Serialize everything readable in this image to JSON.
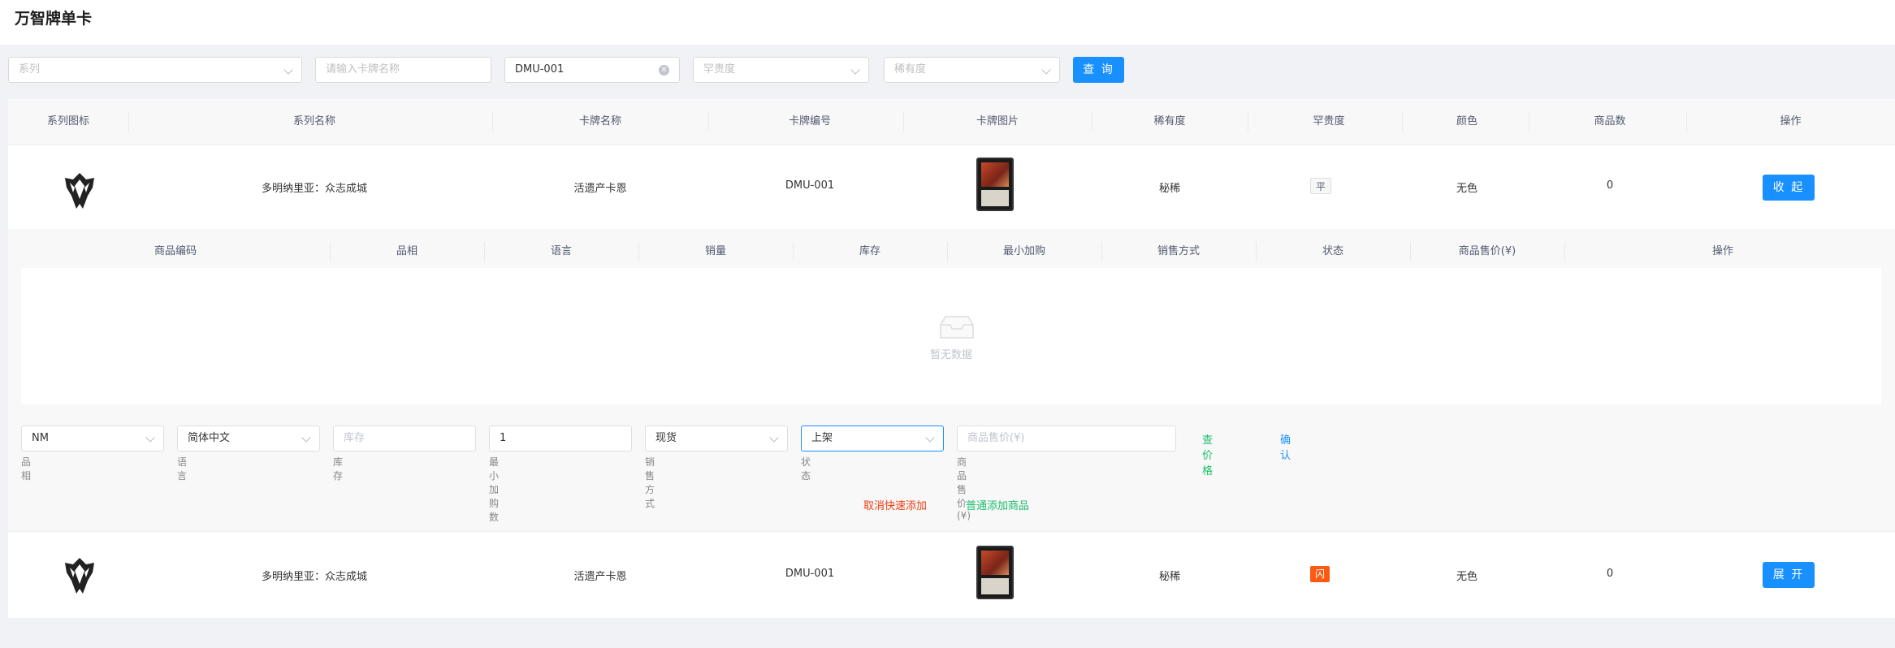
{
  "app": {
    "title": "万智牌单卡"
  },
  "filters": {
    "series_placeholder": "系列",
    "name_placeholder": "请输入卡牌名称",
    "code_value": "DMU-001",
    "rarity_placeholder": "罕贵度",
    "scarcity_placeholder": "稀有度",
    "query_label": "查 询"
  },
  "table": {
    "headers": [
      "系列图标",
      "系列名称",
      "卡牌名称",
      "卡牌编号",
      "卡牌图片",
      "稀有度",
      "罕贵度",
      "颜色",
      "商品数",
      "操作"
    ],
    "rows": [
      {
        "series": "多明纳里亚：众志成城",
        "name": "活遗产卡恩",
        "code": "DMU-001",
        "scarcity": "秘稀",
        "rarity_tag": "平",
        "color": "无色",
        "count": "0",
        "action": "收 起"
      },
      {
        "series": "多明纳里亚：众志成城",
        "name": "活遗产卡恩",
        "code": "DMU-001",
        "scarcity": "秘稀",
        "rarity_tag": "闪",
        "color": "无色",
        "count": "0",
        "action": "展 开"
      }
    ]
  },
  "subtable": {
    "headers": [
      "商品编码",
      "品相",
      "语言",
      "销量",
      "库存",
      "最小加购",
      "销售方式",
      "状态",
      "商品售价(¥)",
      "操作"
    ],
    "empty_text": "暂无数据"
  },
  "add_form": {
    "condition": {
      "value": "NM",
      "label": "品相"
    },
    "language": {
      "value": "简体中文",
      "label": "语言"
    },
    "stock": {
      "placeholder": "库存",
      "label": "库存"
    },
    "min_qty": {
      "value": "1",
      "label": "最小加购数"
    },
    "sale_method": {
      "value": "现货",
      "label": "销售方式"
    },
    "status": {
      "value": "上架",
      "label": "状态"
    },
    "price": {
      "placeholder": "商品售价(¥)",
      "label": "商品售价(¥)"
    },
    "check_price": "查价格",
    "confirm": "确认",
    "cancel_quick_add": "取消快速添加",
    "normal_add": "普通添加商品"
  },
  "colors": {
    "primary": "#1890ff",
    "green_link": "#19be6b",
    "red_link": "#ed4014",
    "flash_tag": "#fa5a14"
  }
}
